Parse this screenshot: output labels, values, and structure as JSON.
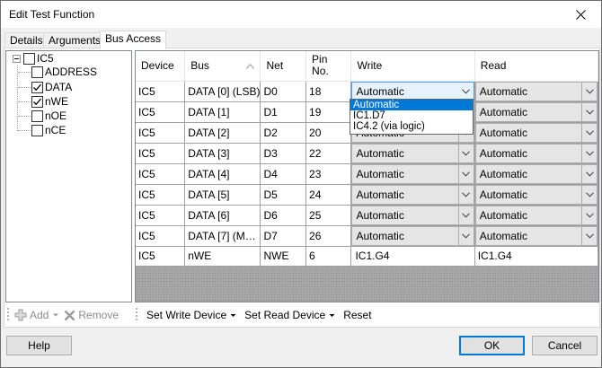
{
  "window": {
    "title": "Edit Test Function"
  },
  "tabs": [
    {
      "label": "Details"
    },
    {
      "label": "Arguments"
    },
    {
      "label": "Bus Access"
    }
  ],
  "tree": {
    "root": {
      "label": "IC5",
      "checked": false
    },
    "items": [
      {
        "label": "ADDRESS",
        "checked": false
      },
      {
        "label": "DATA",
        "checked": true
      },
      {
        "label": "nWE",
        "checked": true
      },
      {
        "label": "nOE",
        "checked": false
      },
      {
        "label": "nCE",
        "checked": false
      }
    ]
  },
  "left_toolbar": {
    "add_label": "Add",
    "remove_label": "Remove"
  },
  "grid": {
    "columns": [
      "Device",
      "Bus",
      "Net",
      "Pin\nNo.",
      "Write",
      "Read"
    ],
    "rows": [
      {
        "device": "IC5",
        "bus": "DATA [0] (LSB)",
        "net": "D0",
        "pin": "18",
        "write": "Automatic",
        "read": "Automatic"
      },
      {
        "device": "IC5",
        "bus": "DATA [1]",
        "net": "D1",
        "pin": "19",
        "write": "Automatic",
        "read": "Automatic"
      },
      {
        "device": "IC5",
        "bus": "DATA [2]",
        "net": "D2",
        "pin": "20",
        "write": "Automatic",
        "read": "Automatic"
      },
      {
        "device": "IC5",
        "bus": "DATA [3]",
        "net": "D3",
        "pin": "22",
        "write": "Automatic",
        "read": "Automatic"
      },
      {
        "device": "IC5",
        "bus": "DATA [4]",
        "net": "D4",
        "pin": "23",
        "write": "Automatic",
        "read": "Automatic"
      },
      {
        "device": "IC5",
        "bus": "DATA [5]",
        "net": "D5",
        "pin": "24",
        "write": "Automatic",
        "read": "Automatic"
      },
      {
        "device": "IC5",
        "bus": "DATA [6]",
        "net": "D6",
        "pin": "25",
        "write": "Automatic",
        "read": "Automatic"
      },
      {
        "device": "IC5",
        "bus": "DATA [7] (M…",
        "net": "D7",
        "pin": "26",
        "write": "Automatic",
        "read": "Automatic"
      },
      {
        "device": "IC5",
        "bus": "nWE",
        "net": "NWE",
        "pin": "6",
        "write": "IC1.G4",
        "read": "IC1.G4"
      }
    ]
  },
  "dropdown": {
    "options": [
      "Automatic",
      "IC1.D7",
      "IC4.2 (via logic)"
    ],
    "selected": "Automatic"
  },
  "right_toolbar": {
    "set_write_label": "Set Write Device",
    "set_read_label": "Set Read Device",
    "reset_label": "Reset"
  },
  "buttons": {
    "help": "Help",
    "ok": "OK",
    "cancel": "Cancel"
  },
  "colors": {
    "accent": "#0078d7",
    "combo_bg": "#e5e5e5",
    "grid_empty": "#a8a8a8"
  }
}
